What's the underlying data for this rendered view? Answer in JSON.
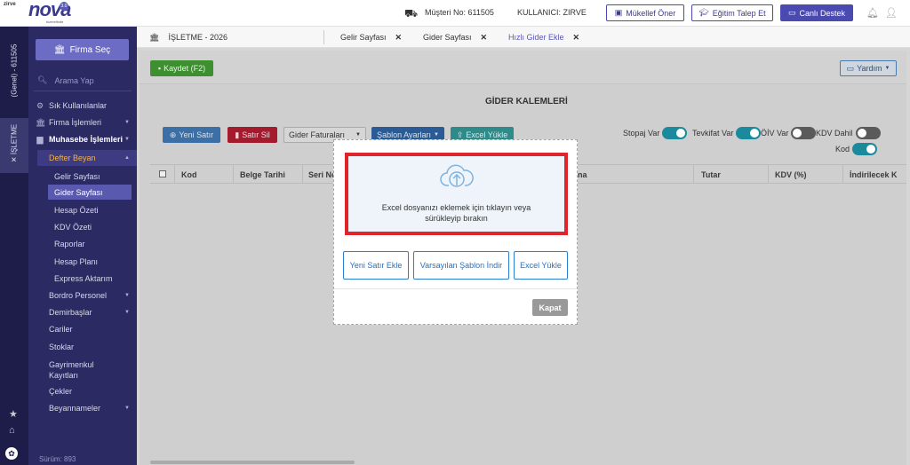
{
  "brand": {
    "small": "zirve",
    "name": "nova",
    "badge": "3.0",
    "sub": "hizmetinde"
  },
  "top": {
    "customer": "Müşteri No: 611505",
    "user": "KULLANICI: ZIRVE",
    "btn_mukellef": "Mükellef Öner",
    "btn_egitim": "Eğitim Talep Et",
    "btn_destek": "Canlı Destek"
  },
  "rail": {
    "account": "(Genel) - 611505",
    "module": "İŞLETME"
  },
  "sidebar": {
    "firma_button": "Firma Seç",
    "search_placeholder": "Arama Yap",
    "items": [
      {
        "label": "Sık Kullanılanlar"
      },
      {
        "label": "Firma İşlemleri"
      },
      {
        "label": "Muhasebe İşlemleri"
      },
      {
        "label": "Defter Beyan"
      }
    ],
    "subitems": [
      "Gelir Sayfası",
      "Gider Sayfası",
      "Hesap Özeti",
      "KDV Özeti",
      "Raporlar",
      "Hesap Planı",
      "Express Aktarım"
    ],
    "more": [
      "Bordro Personel",
      "Demirbaşlar",
      "Cariler",
      "Stoklar",
      "Gayrimenkul Kayıtları",
      "Çekler",
      "Beyannameler"
    ],
    "version": "Sürüm: 893"
  },
  "tabs": {
    "company": "İŞLETME - 2026",
    "t1": "Gelir Sayfası",
    "t2": "Gider Sayfası",
    "t3": "Hızlı Gider Ekle"
  },
  "toolbar": {
    "save": "Kaydet (F2)",
    "help": "Yardım",
    "title": "GİDER KALEMLERİ",
    "new_row": "Yeni Satır",
    "delete_row": "Satır Sil",
    "invoices": "Gider Faturaları",
    "template": "Şablon Ayarları",
    "excel": "Excel Yükle",
    "stopaj": "Stopaj Var",
    "tevkifat": "Tevkifat Var",
    "oiv": "ÖİV Var",
    "kdv_dahil": "KDV Dahil",
    "kod": "Kod"
  },
  "table": {
    "headers": [
      "Kod",
      "Belge Tarihi",
      "Seri No",
      "na",
      "Tutar",
      "KDV (%)",
      "İndirilecek K"
    ]
  },
  "modal": {
    "drop_text": "Excel dosyanızı eklemek için tıklayın veya sürükleyip bırakın",
    "btn_new": "Yeni Satır Ekle",
    "btn_template": "Varsayılan Şablon İndir",
    "btn_excel": "Excel Yükle",
    "close": "Kapat"
  },
  "colors": {
    "sidebar": "#2b2a62",
    "accent": "#4b4ab0",
    "teal": "#1a8a9c",
    "danger": "#e0242c"
  }
}
